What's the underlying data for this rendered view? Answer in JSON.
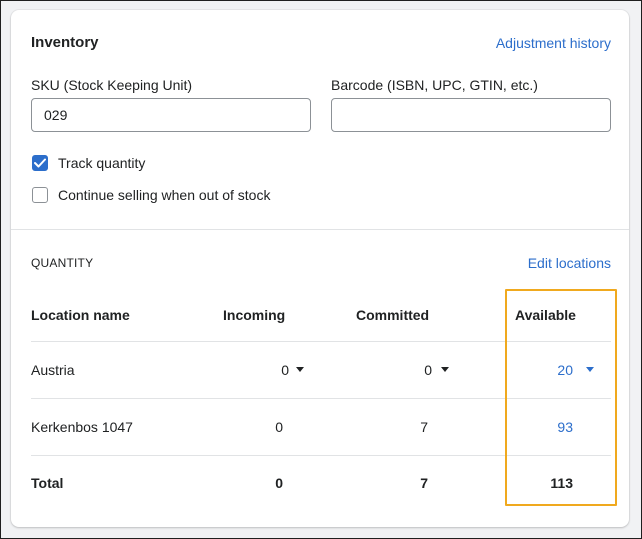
{
  "card": {
    "title": "Inventory",
    "adjustment_history_link": "Adjustment history"
  },
  "sku": {
    "label": "SKU (Stock Keeping Unit)",
    "value": "029"
  },
  "barcode": {
    "label": "Barcode (ISBN, UPC, GTIN, etc.)",
    "value": ""
  },
  "checkboxes": {
    "track_quantity": {
      "label": "Track quantity",
      "checked": true
    },
    "continue_selling": {
      "label": "Continue selling when out of stock",
      "checked": false
    }
  },
  "quantity": {
    "section_label": "QUANTITY",
    "edit_locations_link": "Edit locations",
    "columns": {
      "location": "Location name",
      "incoming": "Incoming",
      "committed": "Committed",
      "available": "Available"
    },
    "rows": [
      {
        "location": "Austria",
        "incoming": "0",
        "committed": "0",
        "available": "20"
      },
      {
        "location": "Kerkenbos 1047",
        "incoming": "0",
        "committed": "7",
        "available": "93"
      }
    ],
    "total": {
      "label": "Total",
      "incoming": "0",
      "committed": "7",
      "available": "113"
    }
  },
  "colors": {
    "accent": "#2c6ecb",
    "highlight": "#f0a91e"
  }
}
